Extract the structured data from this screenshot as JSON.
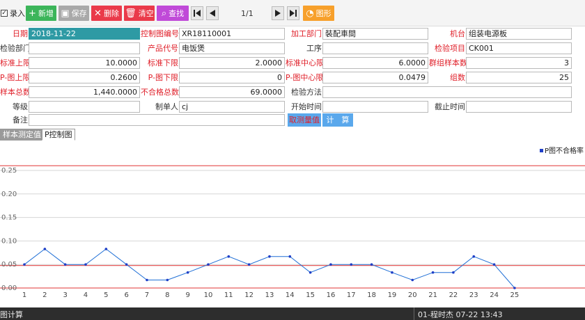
{
  "toolbar": {
    "entry_label": "录入",
    "add_label": "新增",
    "save_label": "保存",
    "delete_label": "删除",
    "clear_label": "清空",
    "search_label": "查找",
    "chart_label": "图形",
    "page_indicator": "1/1",
    "colors": {
      "add": "#3cb55a",
      "save": "#a9a9a9",
      "delete": "#ea3a4a",
      "clear": "#ea3a4a",
      "search": "#c04ad8",
      "chart": "#f7a02b"
    }
  },
  "form": {
    "date": {
      "label": "日期",
      "value": "2018-11-22"
    },
    "chart_no": {
      "label": "控制图编号",
      "value": "XR18110001"
    },
    "dept": {
      "label": "加工部门",
      "value": "裝配車間"
    },
    "machine": {
      "label": "机台",
      "value": "组装电源板"
    },
    "inspect_dept": {
      "label": "检验部门",
      "value": ""
    },
    "product_code": {
      "label": "产品代号",
      "value": "电饭煲"
    },
    "process": {
      "label": "工序",
      "value": ""
    },
    "inspect_item": {
      "label": "检验项目",
      "value": "CK001"
    },
    "std_upper": {
      "label": "标准上限",
      "value": "10.0000"
    },
    "std_lower": {
      "label": "标准下限",
      "value": "2.0000"
    },
    "std_center": {
      "label": "标准中心限",
      "value": "6.0000"
    },
    "group_samples": {
      "label": "群组样本数",
      "value": "3"
    },
    "p_upper": {
      "label": "P-图上限",
      "value": "0.2600"
    },
    "p_lower": {
      "label": "P-图下限",
      "value": "0"
    },
    "p_center": {
      "label": "P-图中心限",
      "value": "0.0479"
    },
    "groups": {
      "label": "组数",
      "value": "25"
    },
    "total_samples": {
      "label": "样本总数",
      "value": "1,440.0000"
    },
    "total_defects": {
      "label": "不合格总数",
      "value": "69.0000"
    },
    "method": {
      "label": "检验方法",
      "value": ""
    },
    "grade": {
      "label": "等级",
      "value": ""
    },
    "creator": {
      "label": "制单人",
      "value": "cj"
    },
    "start_time": {
      "label": "开始时间",
      "value": ""
    },
    "end_time": {
      "label": "截止时间",
      "value": ""
    },
    "remark": {
      "label": "备注",
      "value": ""
    },
    "fetch_button": "取测量值",
    "calc_button": "计　算"
  },
  "tabs": [
    {
      "label": "样本测定值"
    },
    {
      "label": "P控制图"
    }
  ],
  "chart_data": {
    "type": "line",
    "legend": "P图不合格率",
    "legend_position": "top-right",
    "x": [
      1,
      2,
      3,
      4,
      5,
      6,
      7,
      8,
      9,
      10,
      11,
      12,
      13,
      14,
      15,
      16,
      17,
      18,
      19,
      20,
      21,
      22,
      23,
      24,
      25
    ],
    "series": [
      {
        "name": "P图不合格率",
        "values": [
          0.05,
          0.083,
          0.05,
          0.05,
          0.083,
          0.05,
          0.017,
          0.017,
          0.033,
          0.05,
          0.067,
          0.05,
          0.067,
          0.067,
          0.033,
          0.05,
          0.05,
          0.05,
          0.033,
          0.017,
          0.033,
          0.033,
          0.067,
          0.05,
          0.0
        ]
      }
    ],
    "y_ticks": [
      "0.00",
      "0.05",
      "0.10",
      "0.15",
      "0.20",
      "0.25"
    ],
    "ylim": [
      0,
      0.26
    ],
    "control_lines": {
      "upper": 0.26,
      "center": 0.0479,
      "lower": 0
    },
    "grid": true,
    "colors": {
      "line": "#1f6fd6",
      "marker": "#1f3fc7",
      "control": "#e85c5c",
      "grid": "#d6d6d6"
    }
  },
  "status": {
    "left": "图计算",
    "right": "01-程时杰 07-22 13:43"
  }
}
